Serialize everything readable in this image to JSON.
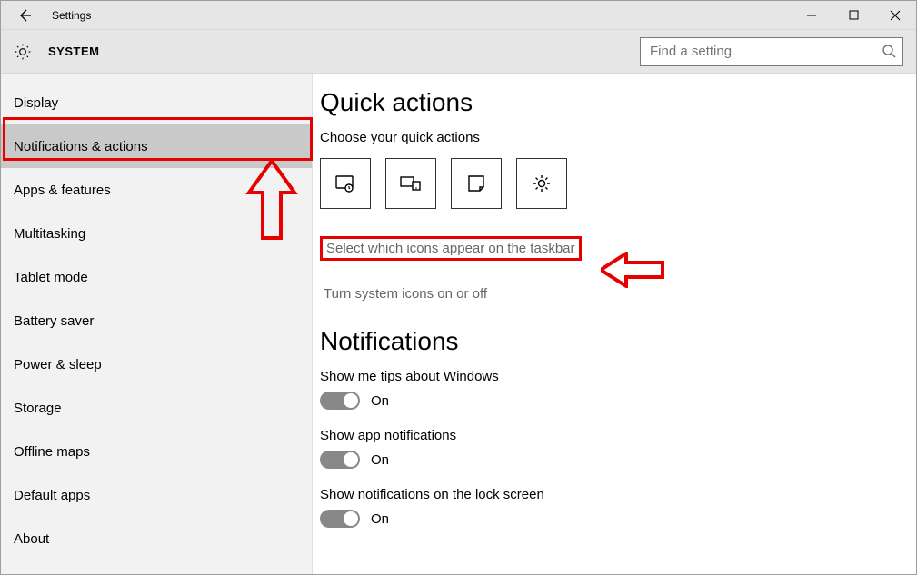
{
  "window": {
    "title": "Settings"
  },
  "header": {
    "title": "SYSTEM"
  },
  "search": {
    "placeholder": "Find a setting"
  },
  "sidebar": {
    "items": [
      {
        "label": "Display",
        "selected": false
      },
      {
        "label": "Notifications & actions",
        "selected": true
      },
      {
        "label": "Apps & features",
        "selected": false
      },
      {
        "label": "Multitasking",
        "selected": false
      },
      {
        "label": "Tablet mode",
        "selected": false
      },
      {
        "label": "Battery saver",
        "selected": false
      },
      {
        "label": "Power & sleep",
        "selected": false
      },
      {
        "label": "Storage",
        "selected": false
      },
      {
        "label": "Offline maps",
        "selected": false
      },
      {
        "label": "Default apps",
        "selected": false
      },
      {
        "label": "About",
        "selected": false
      }
    ]
  },
  "content": {
    "section1": {
      "heading": "Quick actions",
      "sub": "Choose your quick actions",
      "link1": "Select which icons appear on the taskbar",
      "link2": "Turn system icons on or off"
    },
    "section2": {
      "heading": "Notifications",
      "settings": [
        {
          "label": "Show me tips about Windows",
          "state": "On"
        },
        {
          "label": "Show app notifications",
          "state": "On"
        },
        {
          "label": "Show notifications on the lock screen",
          "state": "On"
        }
      ]
    }
  }
}
